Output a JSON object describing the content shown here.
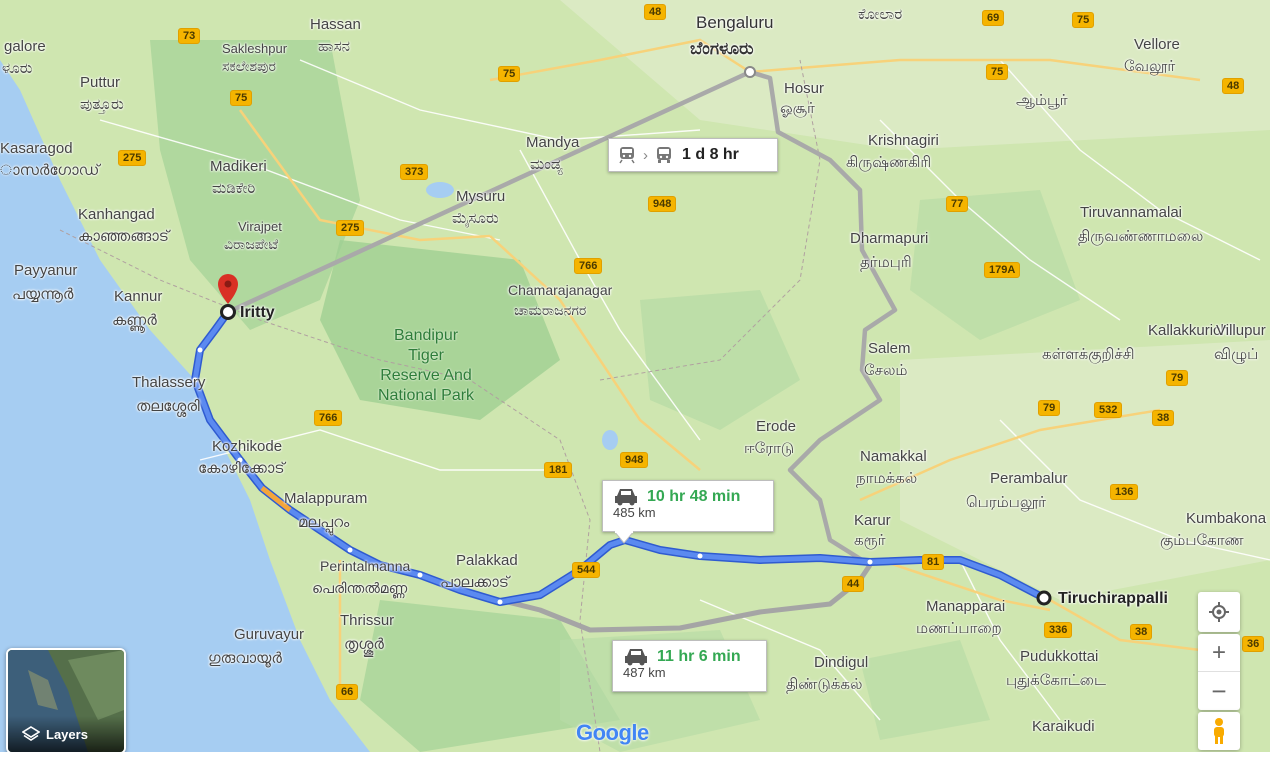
{
  "places": {
    "hassan": "Hassan",
    "hassan_local": "ಹಾಸನ",
    "bengaluru": "Bengaluru",
    "bengaluru_local": "ಬೆಂಗಳೂರು",
    "kolar_local": "ಕೋಲಾರ",
    "vellore": "Vellore",
    "vellore_local": "வேலூர்",
    "ambur_local": "ஆம்பூர்",
    "mangalore": "galore",
    "mangalore_local": "ಳೂರು",
    "sakleshpur": "Sakleshpur",
    "sakleshpur_local": "ಸಕಲೇಶಪುರ",
    "puttur": "Puttur",
    "puttur_local": "ಪುತ್ತೂರು",
    "hosur": "Hosur",
    "hosur_local": "ஓசூர்",
    "mandya": "Mandya",
    "mandya_local": "ಮಂಡ್ಯ",
    "kasaragod": "Kasaragod",
    "kasaragod_local": "ാസർഗോഡ്",
    "madikeri": "Madikeri",
    "madikeri_local": "ಮಡಿಕೇರಿ",
    "krishnagiri": "Krishnagiri",
    "krishnagiri_local": "கிருஷ்ணகிரி",
    "mysuru": "Mysuru",
    "mysuru_local": "ಮೈಸೂರು",
    "kanhangad": "Kanhangad",
    "kanhangad_local": "കാഞ്ഞങ്ങാട്",
    "virajpet": "Virajpet",
    "virajpet_local": "ವಿರಾಜಪೇಟೆ",
    "tiruvannamalai": "Tiruvannamalai",
    "tiruvannamalai_local": "திருவண்ணாமலை",
    "dharmapuri": "Dharmapuri",
    "dharmapuri_local": "தர்மபுரி",
    "payyanur": "Payyanur",
    "payyanur_local": "പയ്യന്നൂർ",
    "kannur": "Kannur",
    "kannur_local": "കണ്ണൂർ",
    "chamarajanagar": "Chamarajanagar",
    "chamarajanagar_local": "ಚಾಮರಾಜನಗರ",
    "iritty": "Iritty",
    "kallakkurichi": "Kallakkurichi",
    "kallakkurichi_local": "கள்ளக்குறிச்சி",
    "villupuram": "Villupur",
    "villupuram_local": "விழுப்",
    "park_1": "Bandipur",
    "park_2": "Tiger",
    "park_3": "Reserve And",
    "park_4": "National Park",
    "salem": "Salem",
    "salem_local": "சேலம்",
    "thalassery": "Thalassery",
    "thalassery_local": "തലശ്ശേരി",
    "erode": "Erode",
    "erode_local": "ஈரோடு",
    "kozhikode": "Kozhikode",
    "kozhikode_local": "കോഴിക്കോട്",
    "namakkal": "Namakkal",
    "namakkal_local": "நாமக்கல்",
    "perambalur": "Perambalur",
    "perambalur_local": "பெரம்பலூர்",
    "malappuram": "Malappuram",
    "malappuram_local": "മലപ്പുറം",
    "karur": "Karur",
    "karur_local": "கரூர்",
    "kumbakonam": "Kumbakona",
    "kumbakonam_local": "கும்பகோண",
    "palakkad": "Palakkad",
    "palakkad_local": "പാലക്കാട്",
    "perintalmanna": "Perintalmanna",
    "perintalmanna_local": "പെരിന്തൽമണ്ണ",
    "tiruchirappalli": "Tiruchirappalli",
    "manapparai": "Manapparai",
    "manapparai_local": "மணப்பாறை",
    "thrissur": "Thrissur",
    "thrissur_local": "തൃശ്ശൂർ",
    "guruvayur": "Guruvayur",
    "guruvayur_local": "ഗുരുവായൂർ",
    "dindigul": "Dindigul",
    "dindigul_local": "திண்டுக்கல்",
    "pudukkottai": "Pudukkottai",
    "pudukkottai_local": "புதுக்கோட்டை",
    "karaikudi": "Karaikudi"
  },
  "shields": {
    "s48a": "48",
    "s69": "69",
    "s73": "73",
    "s75a": "75",
    "s75b": "75",
    "s75c": "75",
    "s48b": "48",
    "s275a": "275",
    "s373": "373",
    "s948a": "948",
    "s77": "77",
    "s275b": "275",
    "s766a": "766",
    "s179a": "179A",
    "s766b": "766",
    "s79": "79",
    "s532": "532",
    "s38": "38",
    "s181": "181",
    "s948b": "948",
    "s136": "136",
    "s81": "81",
    "s544": "544",
    "s44": "44",
    "s336": "336",
    "s36": "36",
    "s66": "66"
  },
  "routes": {
    "transit": {
      "duration": "1 d 8 hr"
    },
    "drive_main": {
      "duration": "10 hr 48 min",
      "distance": "485 km"
    },
    "drive_alt": {
      "duration": "11 hr 6 min",
      "distance": "487 km"
    }
  },
  "controls": {
    "layers_label": "Layers"
  },
  "attribution": "Google",
  "colors": {
    "route_main": "#4c7df0",
    "route_alt": "#9e9e9e",
    "duration_main": "#34a853",
    "duration_alt": "#34a853",
    "pin": "#d93025"
  },
  "icons": {
    "transit": "train-icon",
    "bus": "bus-icon",
    "car": "car-icon",
    "pin": "map-pin-icon",
    "layers": "layers-icon",
    "locate": "my-location-icon",
    "zoom_in": "plus-icon",
    "zoom_out": "minus-icon",
    "pegman": "pegman-icon"
  }
}
